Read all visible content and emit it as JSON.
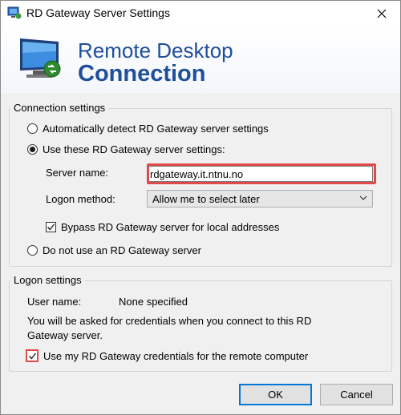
{
  "window": {
    "title": "RD Gateway Server Settings",
    "icon": "rd-gateway-icon",
    "close_icon": "close-icon"
  },
  "banner": {
    "line1": "Remote Desktop",
    "line2": "Connection",
    "logo_icon": "remote-desktop-monitor-icon",
    "brand_color": "#1f4f9a"
  },
  "connection_settings": {
    "title": "Connection settings",
    "option_auto": "Automatically detect RD Gateway server settings",
    "option_use": "Use these RD Gateway server settings:",
    "server_name_label": "Server name:",
    "server_name_value": "rdgateway.it.ntnu.no",
    "logon_method_label": "Logon method:",
    "logon_method_value": "Allow me to select later",
    "bypass_label": "Bypass RD Gateway server for local addresses",
    "bypass_checked": true,
    "option_none": "Do not use an RD Gateway server",
    "selected_option": "use"
  },
  "logon_settings": {
    "title": "Logon settings",
    "user_name_label": "User name:",
    "user_name_value": "None specified",
    "info_text": "You will be asked for credentials when you connect to this RD Gateway server.",
    "use_credentials_label": "Use my RD Gateway credentials for the remote computer",
    "use_credentials_checked": true
  },
  "buttons": {
    "ok": "OK",
    "cancel": "Cancel"
  },
  "highlight_color": "#e04a4a"
}
